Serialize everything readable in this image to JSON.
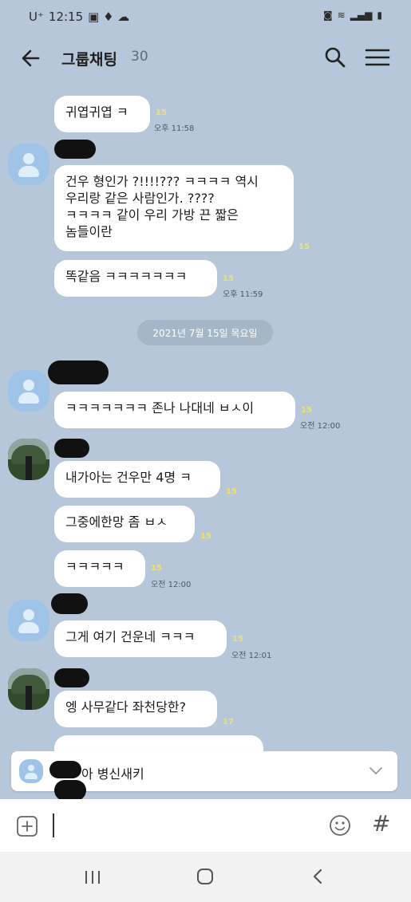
{
  "status_bar": {
    "carrier": "U⁺",
    "time": "12:15"
  },
  "header": {
    "title": "그룹채팅",
    "member_count": "30"
  },
  "messages": [
    {
      "text": "귀엽귀엽 ㅋ",
      "unread": "15",
      "time": "오후 11:58"
    },
    {
      "text": "건우 형인가 ?!!!!??? ㅋㅋㅋㅋ 역시\n우리랑 같은 사람인가. ????\nㅋㅋㅋㅋ 같이 우리 가방 끈 짧은\n놈들이란",
      "unread": "15"
    },
    {
      "text": "똑같음 ㅋㅋㅋㅋㅋㅋㅋ",
      "unread": "15",
      "time": "오후 11:59"
    },
    {
      "text": "ㅋㅋㅋㅋㅋㅋㅋ 존나 나대네 ㅂㅅ이",
      "unread": "15",
      "time": "오전 12:00"
    },
    {
      "text": "내가아는 건우만 4명 ㅋ",
      "unread": "15"
    },
    {
      "text": "그중에한망 좀 ㅂㅅ",
      "unread": "15"
    },
    {
      "text": "ㅋㅋㅋㅋㅋ",
      "unread": "15",
      "time": "오전 12:00"
    },
    {
      "text": "그게 여기 건운네 ㅋㅋㅋ",
      "unread": "15",
      "time": "오전 12:01"
    },
    {
      "text": "엥 사무같다 좌천당한?",
      "unread": "17"
    }
  ],
  "date_divider": "2021년 7월 15일 목요일",
  "notice": {
    "text": "아 병신새키"
  },
  "composer": {
    "hash": "#"
  }
}
